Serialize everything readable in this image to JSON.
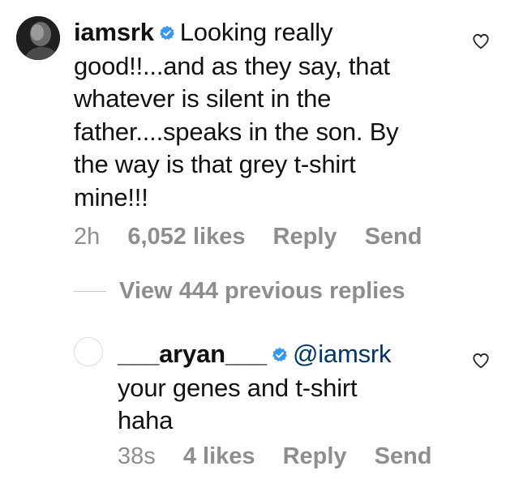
{
  "comment": {
    "username": "iamsrk",
    "verified_icon": "verified-badge-icon",
    "text_lines": [
      "Looking really",
      "good!!...and as they say, that",
      "whatever is silent in the",
      "father....speaks in the son. By",
      "the way is that grey t-shirt",
      "mine!!!"
    ],
    "time": "2h",
    "likes": "6,052 likes",
    "reply_label": "Reply",
    "send_label": "Send"
  },
  "view_replies": "View 444 previous replies",
  "reply": {
    "username": "___aryan___",
    "mention": "@iamsrk",
    "text_lines": [
      "your genes and t-shirt",
      "haha"
    ],
    "time": "38s",
    "likes": "4 likes",
    "reply_label": "Reply",
    "send_label": "Send"
  },
  "colors": {
    "verified": "#3897f0",
    "meta": "#8e8e8e",
    "mention": "#003569",
    "heart_stroke": "#262626"
  }
}
